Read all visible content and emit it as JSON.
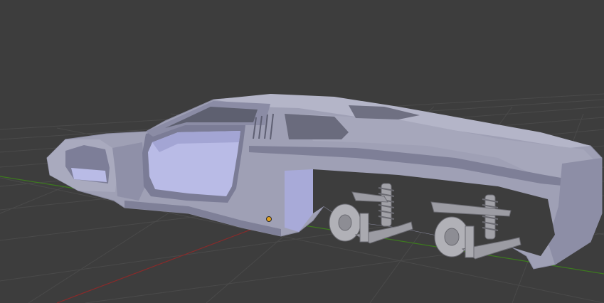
{
  "viewport": {
    "background_color": "#3d3d3d",
    "grid_line_color": "#4a4a4a",
    "x_axis_color": "#8a2a2a",
    "y_axis_color": "#3d7a1e"
  },
  "object": {
    "type": "car-body-mesh",
    "body_color": "#9fa0b5",
    "body_shade_color": "#7e7f97",
    "interior_color": "#b9bbe6",
    "suspension_color": "#a7a7ad",
    "origin_color": "#e0a020"
  }
}
